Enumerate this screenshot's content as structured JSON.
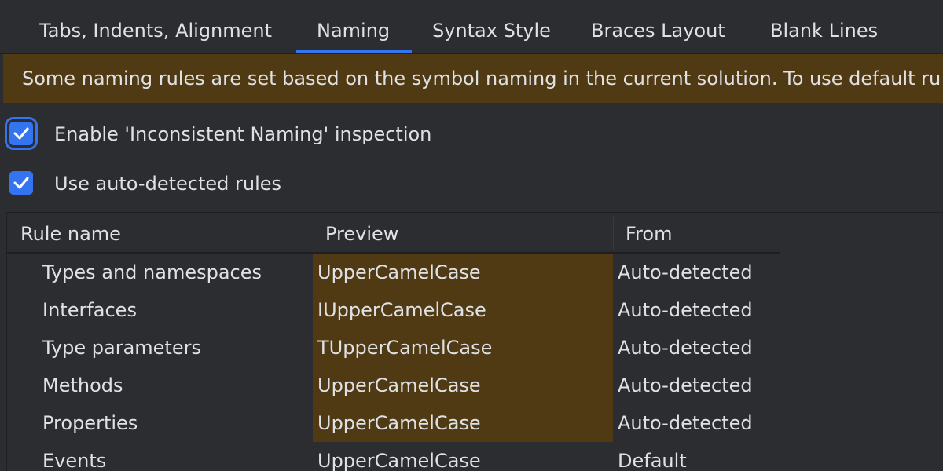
{
  "tabs": [
    {
      "label": "Tabs, Indents, Alignment",
      "active": false
    },
    {
      "label": "Naming",
      "active": true
    },
    {
      "label": "Syntax Style",
      "active": false
    },
    {
      "label": "Braces Layout",
      "active": false
    },
    {
      "label": "Blank Lines",
      "active": false
    }
  ],
  "banner": {
    "text": "Some naming rules are set based on the symbol naming in the current solution. To use default ru"
  },
  "options": {
    "enable_inspection": {
      "label": "Enable 'Inconsistent Naming' inspection",
      "checked": true
    },
    "use_auto_detected": {
      "label": "Use auto-detected rules",
      "checked": true
    }
  },
  "table": {
    "columns": [
      "Rule name",
      "Preview",
      "From"
    ],
    "rows": [
      {
        "name": "Types and namespaces",
        "preview": "UpperCamelCase",
        "from": "Auto-detected"
      },
      {
        "name": "Interfaces",
        "preview": "IUpperCamelCase",
        "from": "Auto-detected"
      },
      {
        "name": "Type parameters",
        "preview": "TUpperCamelCase",
        "from": "Auto-detected"
      },
      {
        "name": "Methods",
        "preview": "UpperCamelCase",
        "from": "Auto-detected"
      },
      {
        "name": "Properties",
        "preview": "UpperCamelCase",
        "from": "Auto-detected"
      },
      {
        "name": "Events",
        "preview": "UpperCamelCase",
        "from": "Default"
      }
    ]
  },
  "colors": {
    "background": "#2b2d30",
    "accent": "#3574f0",
    "highlight": "#4f3a13",
    "text": "#dfe1e5"
  },
  "icons": {
    "checkbox_checked": "check-icon"
  }
}
